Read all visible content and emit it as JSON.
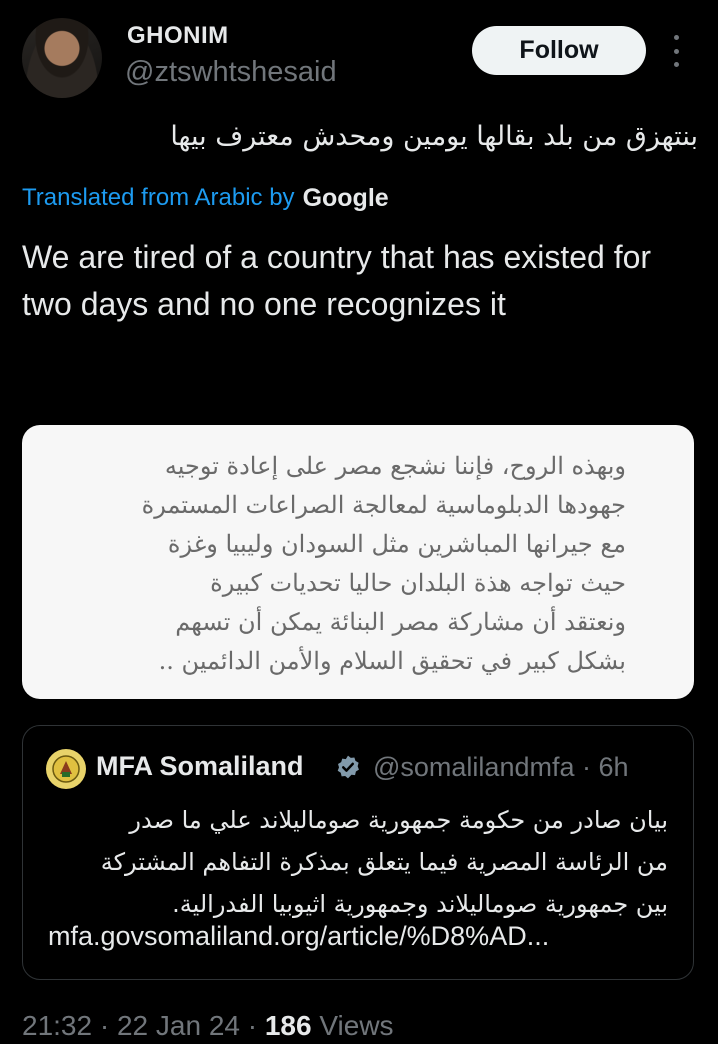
{
  "author": {
    "display_name": "GHONIM",
    "handle": "@ztswhtshesaid"
  },
  "follow_button": "Follow",
  "more_icon": "more-vertical-icon",
  "tweet": {
    "original_text": "بنتهزق من بلد بقالها يومين ومحدش معترف بيها",
    "translated_label": "Translated from Arabic by",
    "translation_provider": "Google",
    "translated_text": "We are tired of a country that has existed for two days and no one recognizes it"
  },
  "image": {
    "lines": [
      "وبهذه الروح، فإننا نشجع مصر على إعادة توجيه",
      "جهودها الدبلوماسية لمعالجة الصراعات المستمرة",
      "مع جيرانها المباشرين مثل السودان وليبيا وغزة",
      "حيث تواجه هذة البلدان حاليا تحديات كبيرة",
      "ونعتقد أن مشاركة مصر البنائة يمكن  أن تسهم",
      "بشكل كبير في تحقيق السلام والأمن الدائمين .."
    ]
  },
  "quote": {
    "name": "MFA Somaliland",
    "handle_time": "@somalilandmfa · 6h",
    "verified_icon": "verified-badge-icon",
    "text_lines": [
      "بيان صادر من حكومة جمهورية صوماليلاند علي ما صدر",
      "من الرئاسة المصرية فيما يتعلق بمذكرة التفاهم المشتركة",
      "بين جمهورية صوماليلاند وجمهورية اثيوبيا الفدرالية."
    ],
    "link": "mfa.govsomaliland.org/article/%D8%AD..."
  },
  "meta": {
    "time": "21:32",
    "sep1": " · ",
    "date": "22 Jan 24",
    "sep2": " · ",
    "views_count": "186",
    "views_label": " Views"
  },
  "colors": {
    "background": "#000000",
    "text": "#e7e9ea",
    "secondary": "#71767b",
    "link": "#1d9bf0",
    "verified": "#829aab"
  }
}
